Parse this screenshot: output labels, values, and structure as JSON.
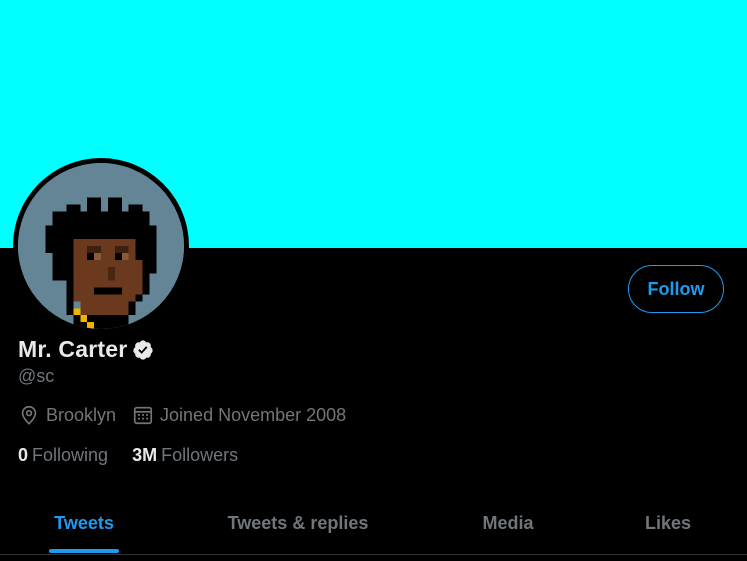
{
  "profile": {
    "display_name": "Mr. Carter",
    "handle": "@sc",
    "location": "Brooklyn",
    "joined": "Joined November 2008",
    "following_count": "0",
    "following_label": "Following",
    "followers_count": "3M",
    "followers_label": "Followers",
    "verified": true
  },
  "actions": {
    "follow_label": "Follow"
  },
  "tabs": [
    {
      "label": "Tweets",
      "active": true
    },
    {
      "label": "Tweets & replies",
      "active": false
    },
    {
      "label": "Media",
      "active": false
    },
    {
      "label": "Likes",
      "active": false
    }
  ],
  "icons": {
    "location": "location-pin-icon",
    "calendar": "calendar-icon",
    "verified": "verified-badge-icon"
  },
  "colors": {
    "banner": "#00ffff",
    "background": "#000000",
    "accent": "#1d9bf0",
    "avatar_bg": "#638596",
    "text_primary": "#e7e9ea",
    "text_secondary": "#71767b"
  }
}
